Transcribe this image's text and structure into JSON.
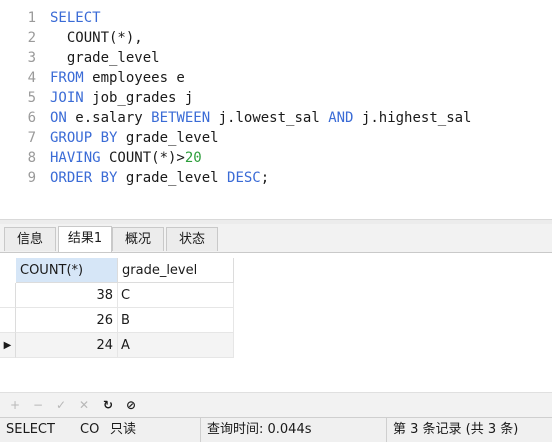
{
  "editor": {
    "lines": [
      {
        "n": "1",
        "t": [
          {
            "c": "kw",
            "v": "SELECT"
          }
        ]
      },
      {
        "n": "2",
        "t": [
          {
            "c": "txt",
            "v": "  COUNT(*),"
          }
        ]
      },
      {
        "n": "3",
        "t": [
          {
            "c": "txt",
            "v": "  grade_level"
          }
        ]
      },
      {
        "n": "4",
        "t": [
          {
            "c": "kw",
            "v": "FROM"
          },
          {
            "c": "txt",
            "v": " employees e"
          }
        ]
      },
      {
        "n": "5",
        "t": [
          {
            "c": "kw",
            "v": "JOIN"
          },
          {
            "c": "txt",
            "v": " job_grades j"
          }
        ]
      },
      {
        "n": "6",
        "t": [
          {
            "c": "kw",
            "v": "ON"
          },
          {
            "c": "txt",
            "v": " e.salary "
          },
          {
            "c": "kw",
            "v": "BETWEEN"
          },
          {
            "c": "txt",
            "v": " j.lowest_sal "
          },
          {
            "c": "kw",
            "v": "AND"
          },
          {
            "c": "txt",
            "v": " j.highest_sal"
          }
        ]
      },
      {
        "n": "7",
        "t": [
          {
            "c": "kw",
            "v": "GROUP BY"
          },
          {
            "c": "txt",
            "v": " grade_level"
          }
        ]
      },
      {
        "n": "8",
        "t": [
          {
            "c": "kw",
            "v": "HAVING"
          },
          {
            "c": "txt",
            "v": " COUNT(*)>"
          },
          {
            "c": "num",
            "v": "20"
          }
        ]
      },
      {
        "n": "9",
        "t": [
          {
            "c": "kw",
            "v": "ORDER BY"
          },
          {
            "c": "txt",
            "v": " grade_level "
          },
          {
            "c": "kw",
            "v": "DESC"
          },
          {
            "c": "txt",
            "v": ";"
          }
        ]
      }
    ]
  },
  "tabs": [
    "信息",
    "结果1",
    "概况",
    "状态"
  ],
  "active_tab": "结果1",
  "result": {
    "columns": [
      "COUNT(*)",
      "grade_level"
    ],
    "rows": [
      {
        "count": "38",
        "grade": "C"
      },
      {
        "count": "26",
        "grade": "B"
      },
      {
        "count": "24",
        "grade": "A"
      }
    ],
    "current_row_marker": "▶"
  },
  "toolbar": {
    "add": "+",
    "delete": "−",
    "apply": "✓",
    "discard": "✕",
    "refresh": "↻",
    "stop": "⊘"
  },
  "status": {
    "query_type": "SELECT",
    "truncated": "CO",
    "mode": "只读",
    "query_time": "查询时间: 0.044s",
    "record_info": "第 3 条记录 (共 3 条)"
  },
  "colors": {
    "keyword": "#3a6bd6",
    "number": "#2e9e3c",
    "selected_header": "#d6e6f7"
  }
}
